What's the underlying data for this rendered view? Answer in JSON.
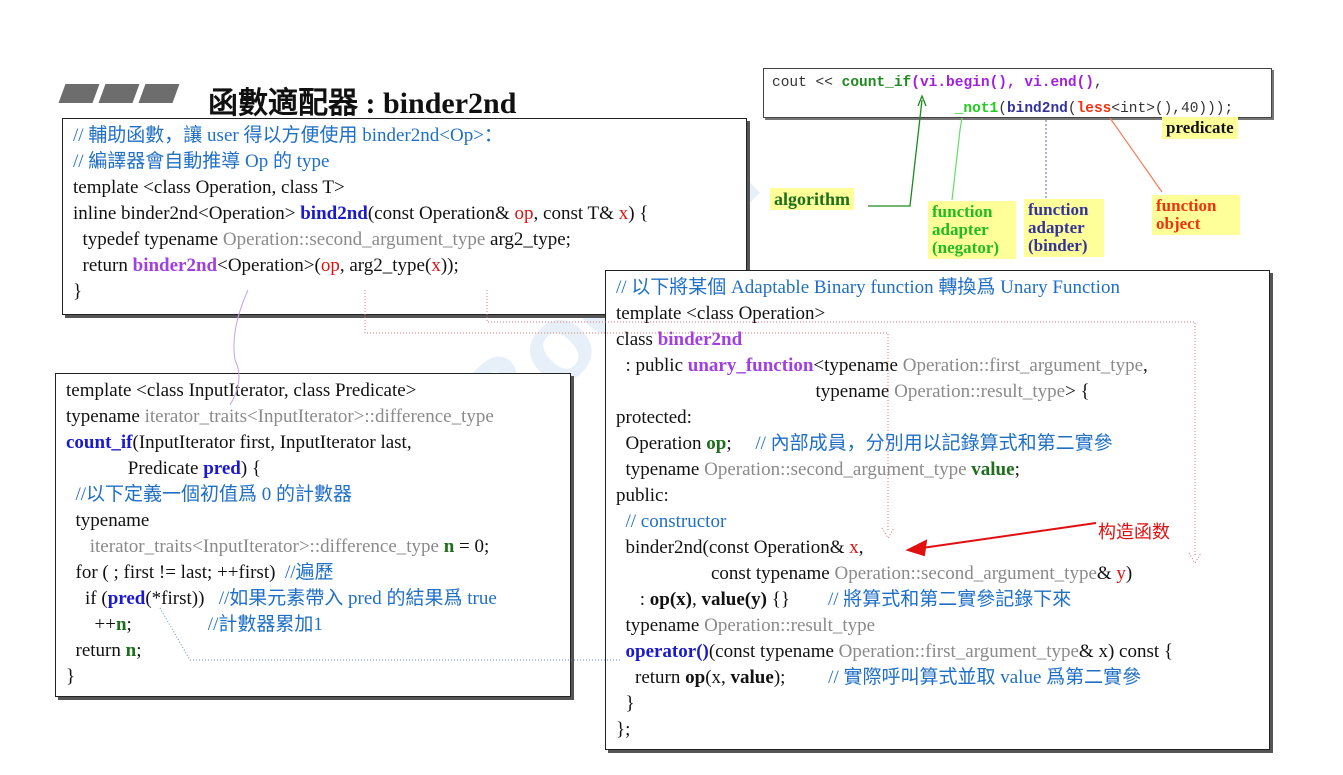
{
  "title": "函數適配器 : binder2nd",
  "usage_code": {
    "lines": [
      [
        [
          "cout << ",
          ""
        ],
        [
          "count_if",
          "m-g"
        ],
        [
          "(vi.begin(), vi.end()",
          "m-p"
        ],
        [
          ",",
          ""
        ]
      ],
      [
        [
          "                     ",
          ""
        ],
        [
          "_not1",
          "m-l"
        ],
        [
          "(",
          ""
        ],
        [
          "bind2nd",
          "m-b"
        ],
        [
          "(",
          ""
        ],
        [
          "less",
          "m-r"
        ],
        [
          "<int>(),40)));",
          ""
        ]
      ]
    ]
  },
  "tags": {
    "predicate": "predicate",
    "algorithm": "algorithm",
    "negator": "function adapter (negator)",
    "binder": "function adapter (binder)",
    "function_object": "function object"
  },
  "annotation": "构造函数",
  "helper_box": {
    "lines": [
      [
        [
          "// 輔助函數，讓 user 得以方便使用 binder2nd<Op>：",
          "c"
        ]
      ],
      [
        [
          "// 編譯器會自動推導 Op 的 type",
          "c"
        ]
      ],
      [
        [
          "template <class Operation, class T>",
          ""
        ]
      ],
      [
        [
          "inline binder2nd<Operation> ",
          ""
        ],
        [
          "bind2nd",
          "b"
        ],
        [
          "(const Operation& ",
          ""
        ],
        [
          "op",
          "r"
        ],
        [
          ", const T& ",
          ""
        ],
        [
          "x",
          "r"
        ],
        [
          ") {",
          ""
        ]
      ],
      [
        [
          "  typedef typename ",
          ""
        ],
        [
          "Operation::second_argument_type",
          "g"
        ],
        [
          " arg2_type;",
          ""
        ]
      ],
      [
        [
          "  return ",
          ""
        ],
        [
          "binder2nd",
          "p"
        ],
        [
          "<Operation>(",
          ""
        ],
        [
          "op",
          "r"
        ],
        [
          ", arg2_type(",
          ""
        ],
        [
          "x",
          "r"
        ],
        [
          "));",
          ""
        ]
      ],
      [
        [
          "}",
          ""
        ]
      ]
    ]
  },
  "count_if_box": {
    "lines": [
      [
        [
          "template <class InputIterator, class Predicate>",
          ""
        ]
      ],
      [
        [
          "typename ",
          ""
        ],
        [
          "iterator_traits<InputIterator>::difference_type",
          "g"
        ]
      ],
      [
        [
          "count_if",
          "b"
        ],
        [
          "(InputIterator first, InputIterator last,",
          ""
        ]
      ],
      [
        [
          "             Predicate ",
          ""
        ],
        [
          "pred",
          "b"
        ],
        [
          ") {",
          ""
        ]
      ],
      [
        [
          "  //以下定義一個初值爲 0 的計數器",
          "c"
        ]
      ],
      [
        [
          "  typename",
          ""
        ]
      ],
      [
        [
          "     ",
          ""
        ],
        [
          "iterator_traits<InputIterator>::difference_type",
          "g"
        ],
        [
          " ",
          ""
        ],
        [
          "n",
          "gb"
        ],
        [
          " = 0;",
          ""
        ]
      ],
      [
        [
          "  for ( ; first != last; ++first)  ",
          ""
        ],
        [
          "//遍歷",
          "c"
        ]
      ],
      [
        [
          "    if (",
          ""
        ],
        [
          "pred",
          "b"
        ],
        [
          "(*first))   ",
          ""
        ],
        [
          "//如果元素帶入 pred 的結果爲 true",
          "c"
        ]
      ],
      [
        [
          "      ++",
          ""
        ],
        [
          "n",
          "gb"
        ],
        [
          ";                ",
          ""
        ],
        [
          "//計數器累加1",
          "c"
        ]
      ],
      [
        [
          "  return ",
          ""
        ],
        [
          "n",
          "gb"
        ],
        [
          ";",
          ""
        ]
      ],
      [
        [
          "}",
          ""
        ]
      ]
    ]
  },
  "binder_box": {
    "lines": [
      [
        [
          "// 以下將某個 Adaptable Binary function 轉換爲 Unary Function",
          "c"
        ]
      ],
      [
        [
          "template <class Operation>",
          ""
        ]
      ],
      [
        [
          "class ",
          ""
        ],
        [
          "binder2nd",
          "p"
        ]
      ],
      [
        [
          "  : public ",
          ""
        ],
        [
          "unary_function",
          "p"
        ],
        [
          "<typename ",
          ""
        ],
        [
          "Operation::first_argument_type",
          "g"
        ],
        [
          ",",
          ""
        ]
      ],
      [
        [
          "                                          typename ",
          ""
        ],
        [
          "Operation::result_type",
          "g"
        ],
        [
          "> {",
          ""
        ]
      ],
      [
        [
          "protected:",
          ""
        ]
      ],
      [
        [
          "  Operation ",
          ""
        ],
        [
          "op",
          "gb"
        ],
        [
          ";     ",
          ""
        ],
        [
          "// 內部成員，分別用以記錄算式和第二實參",
          "c"
        ]
      ],
      [
        [
          "  typename ",
          ""
        ],
        [
          "Operation::second_argument_type",
          "g"
        ],
        [
          " ",
          ""
        ],
        [
          "value",
          "gb"
        ],
        [
          ";",
          ""
        ]
      ],
      [
        [
          "public:",
          ""
        ]
      ],
      [
        [
          "  // constructor",
          "c"
        ]
      ],
      [
        [
          "  binder2nd(const Operation& ",
          ""
        ],
        [
          "x",
          "r"
        ],
        [
          ",",
          ""
        ]
      ],
      [
        [
          "                    const typename ",
          ""
        ],
        [
          "Operation::second_argument_type",
          "g"
        ],
        [
          "& ",
          ""
        ],
        [
          "y",
          "r"
        ],
        [
          ")",
          ""
        ]
      ],
      [
        [
          "     : ",
          ""
        ],
        [
          "op(x)",
          "k"
        ],
        [
          ", ",
          ""
        ],
        [
          "value(y)",
          "k"
        ],
        [
          " {}        ",
          ""
        ],
        [
          "// 將算式和第二實參記錄下來",
          "c"
        ]
      ],
      [
        [
          "  typename ",
          ""
        ],
        [
          "Operation::result_type",
          "g"
        ]
      ],
      [
        [
          "  ",
          ""
        ],
        [
          "operator()",
          "b"
        ],
        [
          "(const typename ",
          ""
        ],
        [
          "Operation::first_argument_type",
          "g"
        ],
        [
          "& x) const {",
          ""
        ]
      ],
      [
        [
          "    return ",
          ""
        ],
        [
          "op",
          "k"
        ],
        [
          "(x, ",
          ""
        ],
        [
          "value",
          "k"
        ],
        [
          ");         ",
          ""
        ],
        [
          "// 實際呼叫算式並取 value 爲第二實參",
          "c"
        ]
      ],
      [
        [
          "  }",
          ""
        ]
      ],
      [
        [
          "};",
          ""
        ]
      ]
    ]
  }
}
